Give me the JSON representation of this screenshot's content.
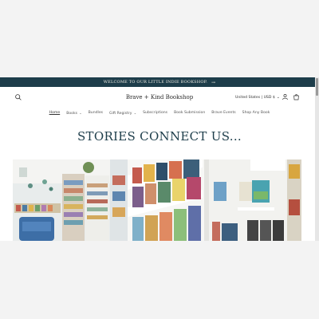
{
  "announcement": {
    "text": "WELCOME TO OUR LITTLE INDIE BOOKSHOP.",
    "arrow": "→"
  },
  "header": {
    "title": "Brave + Kind Bookshop",
    "currency": "United States | USD $"
  },
  "nav": {
    "items": [
      {
        "label": "Home",
        "active": true
      },
      {
        "label": "Books",
        "dropdown": true
      },
      {
        "label": "Bundles"
      },
      {
        "label": "Gift Registry",
        "dropdown": true
      },
      {
        "label": "Subscriptions"
      },
      {
        "label": "Book Submission"
      },
      {
        "label": "Brave Events"
      },
      {
        "label": "Shop Any Book"
      }
    ]
  },
  "hero_heading": "STORIES CONNECT US...",
  "colors": {
    "announcement_bg": "#1d3d4a",
    "heading": "#1d3d4a",
    "page_bg": "#ffffff"
  }
}
